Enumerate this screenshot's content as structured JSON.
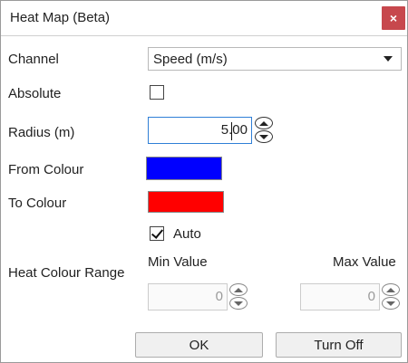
{
  "window": {
    "title": "Heat Map (Beta)",
    "close_glyph": "×"
  },
  "channel": {
    "label": "Channel",
    "selected": "Speed (m/s)"
  },
  "absolute": {
    "label": "Absolute",
    "checked": false
  },
  "radius": {
    "label": "Radius (m)",
    "value": "5.00"
  },
  "from_colour": {
    "label": "From Colour",
    "color": "#0000ff"
  },
  "to_colour": {
    "label": "To Colour",
    "color": "#ff0000"
  },
  "heat_range": {
    "label": "Heat Colour Range",
    "auto_label": "Auto",
    "auto_checked": true,
    "min_label": "Min Value",
    "min_value": "0",
    "max_label": "Max Value",
    "max_value": "0"
  },
  "buttons": {
    "ok": "OK",
    "turn_off": "Turn Off"
  }
}
